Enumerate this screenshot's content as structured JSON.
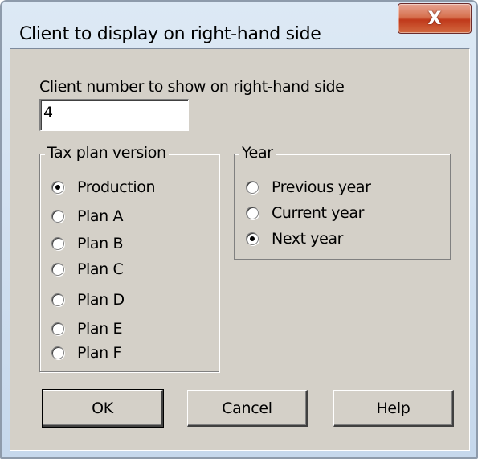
{
  "window": {
    "title": "Client to display on right-hand side",
    "close_label": "X"
  },
  "client_number": {
    "label": "Client number to show on right-hand side",
    "value": "4"
  },
  "tax_plan": {
    "legend": "Tax plan version",
    "options": [
      "Production",
      "Plan A",
      "Plan B",
      "Plan C",
      "Plan D",
      "Plan E",
      "Plan F"
    ],
    "selected": "Production"
  },
  "year": {
    "legend": "Year",
    "options": [
      "Previous year",
      "Current year",
      "Next year"
    ],
    "selected": "Next year"
  },
  "buttons": {
    "ok": "OK",
    "cancel": "Cancel",
    "help": "Help"
  }
}
